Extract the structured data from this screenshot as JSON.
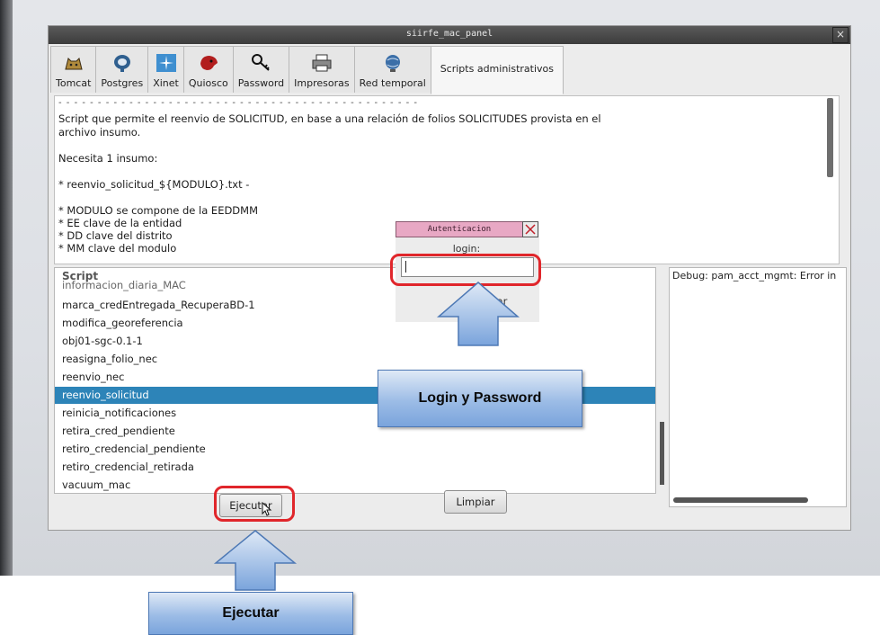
{
  "window": {
    "title": "siirfe_mac_panel"
  },
  "tabs": [
    {
      "label": "Tomcat",
      "icon": "tomcat-icon"
    },
    {
      "label": "Postgres",
      "icon": "postgres-icon"
    },
    {
      "label": "Xinet",
      "icon": "xinet-icon"
    },
    {
      "label": "Quiosco",
      "icon": "quiosco-icon"
    },
    {
      "label": "Password",
      "icon": "key-icon"
    },
    {
      "label": "Impresoras",
      "icon": "printer-icon"
    },
    {
      "label": "Red temporal",
      "icon": "network-icon"
    },
    {
      "label": "Scripts administrativos",
      "icon": ""
    }
  ],
  "description": {
    "line1": "Script que permite el reenvio de SOLICITUD, en base a una relación de folios SOLICITUDES provista en el",
    "line2": "archivo insumo.",
    "line3": "Necesita 1 insumo:",
    "line4": "* reenvio_solicitud_${MODULO}.txt -",
    "line5": "* MODULO se compone de la EEDDMM",
    "line6": "* EE clave de la entidad",
    "line7": "* DD clave del distrito",
    "line8": "* MM clave del modulo"
  },
  "script_list": {
    "header": "Script",
    "items": [
      "informacion_diaria_MAC",
      "marca_credEntregada_RecuperaBD-1",
      "modifica_georeferencia",
      "obj01-sgc-0.1-1",
      "reasigna_folio_nec",
      "reenvio_nec",
      "reenvio_solicitud",
      "reinicia_notificaciones",
      "retira_cred_pendiente",
      "retiro_credencial_pendiente",
      "retiro_credencial_retirada",
      "vacuum_mac"
    ],
    "selected": "reenvio_solicitud"
  },
  "debug": {
    "text": "Debug: pam_acct_mgmt: Error in"
  },
  "buttons": {
    "execute": "Ejecutar",
    "clear": "Limpiar"
  },
  "auth_dialog": {
    "title": "Autenticacion",
    "login_label": "login:",
    "login_value": "",
    "cancel_label": "celar"
  },
  "callouts": {
    "login": "Login y Password",
    "execute": "Ejecutar"
  },
  "colors": {
    "highlight": "#e0262b",
    "selection": "#2d84b8",
    "callout_fill": "#9cbce6",
    "callout_border": "#4e79b5"
  }
}
